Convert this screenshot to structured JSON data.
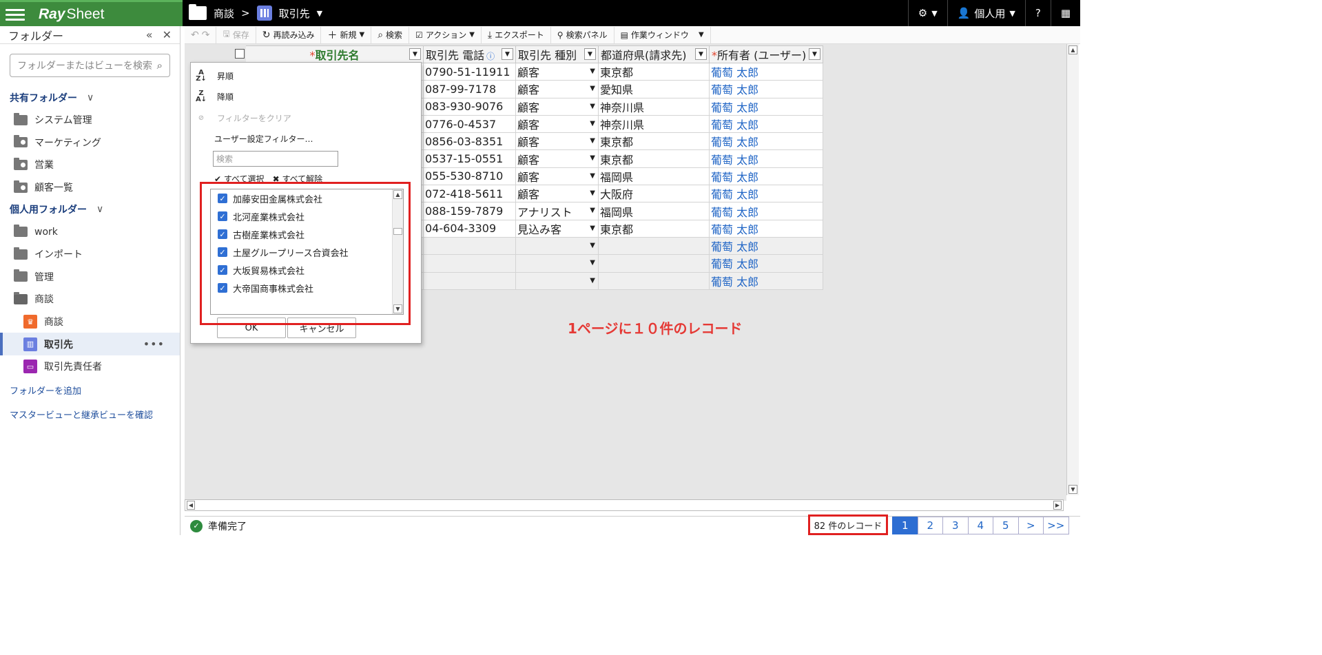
{
  "app": {
    "logo_bold": "Ray",
    "logo_rest": "Sheet"
  },
  "breadcrumb": {
    "parent": "商談",
    "separator": ">",
    "current": "取引先"
  },
  "topright": {
    "user_label": "個人用",
    "help": "?"
  },
  "sidebar": {
    "title": "フォルダー",
    "search_placeholder": "フォルダーまたはビューを検索",
    "shared_title": "共有フォルダー",
    "shared_items": [
      "システム管理",
      "マーケティング",
      "営業",
      "顧客一覧"
    ],
    "personal_title": "個人用フォルダー",
    "personal_items": [
      "work",
      "インポート",
      "管理",
      "商談"
    ],
    "sub_items": [
      "商談",
      "取引先",
      "取引先責任者"
    ],
    "add_folder": "フォルダーを追加",
    "master_view": "マスタービューと継承ビューを確認"
  },
  "toolbar": {
    "save": "保存",
    "reload": "再読み込み",
    "new": "新規",
    "search": "検索",
    "action": "アクション",
    "export": "エクスポート",
    "search_panel": "検索パネル",
    "work_window": "作業ウィンドウ"
  },
  "grid": {
    "headers": {
      "name": "取引先名",
      "phone": "取引先 電話",
      "type": "取引先 種別",
      "pref": "都道府県(請求先)",
      "owner": "所有者 (ユーザー)"
    },
    "rows": [
      {
        "phone": "0790-51-11911",
        "type": "顧客",
        "pref": "東京都",
        "owner": "葡萄 太郎"
      },
      {
        "phone": "087-99-7178",
        "type": "顧客",
        "pref": "愛知県",
        "owner": "葡萄 太郎"
      },
      {
        "phone": "083-930-9076",
        "type": "顧客",
        "pref": "神奈川県",
        "owner": "葡萄 太郎"
      },
      {
        "phone": "0776-0-4537",
        "type": "顧客",
        "pref": "神奈川県",
        "owner": "葡萄 太郎"
      },
      {
        "phone": "0856-03-8351",
        "type": "顧客",
        "pref": "東京都",
        "owner": "葡萄 太郎"
      },
      {
        "phone": "0537-15-0551",
        "type": "顧客",
        "pref": "東京都",
        "owner": "葡萄 太郎"
      },
      {
        "phone": "055-530-8710",
        "type": "顧客",
        "pref": "福岡県",
        "owner": "葡萄 太郎"
      },
      {
        "phone": "072-418-5611",
        "type": "顧客",
        "pref": "大阪府",
        "owner": "葡萄 太郎"
      },
      {
        "phone": "088-159-7879",
        "type": "アナリスト",
        "pref": "福岡県",
        "owner": "葡萄 太郎"
      },
      {
        "phone": "04-604-3309",
        "type": "見込み客",
        "pref": "東京都",
        "owner": "葡萄 太郎"
      }
    ],
    "empty_owner": "葡萄 太郎"
  },
  "banner": "1ページに１０件のレコード",
  "filter_popup": {
    "asc": "昇順",
    "desc": "降順",
    "clear": "フィルターをクリア",
    "custom": "ユーザー設定フィルター…",
    "search_placeholder": "検索",
    "select_all": "すべて選択",
    "deselect_all": "すべて解除",
    "items": [
      "加藤安田金属株式会社",
      "北河産業株式会社",
      "古樹産業株式会社",
      "土屋グループリース合資会社",
      "大坂貿易株式会社",
      "大帝国商事株式会社"
    ],
    "ok": "OK",
    "cancel": "キャンセル"
  },
  "status": {
    "text": "準備完了",
    "record_count": "82 件のレコード",
    "pages": [
      "1",
      "2",
      "3",
      "4",
      "5",
      ">",
      ">>"
    ],
    "current_page": "1"
  },
  "colors": {
    "brand_green": "#3d8b3d",
    "accent_blue": "#2d6dd2",
    "highlight_red": "#e02020"
  }
}
